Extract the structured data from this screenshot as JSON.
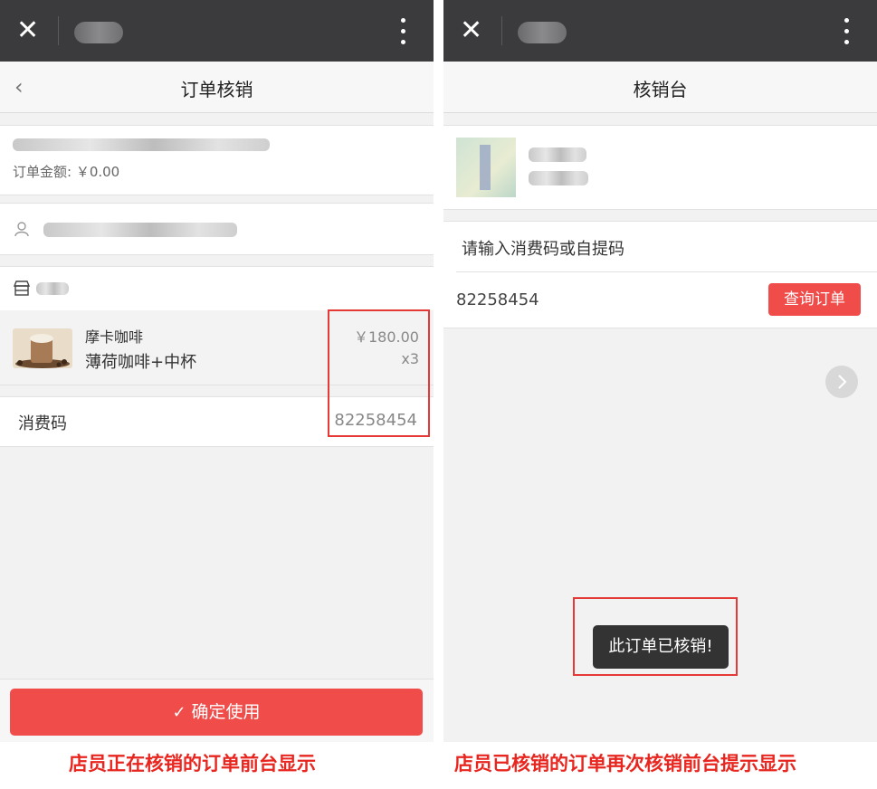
{
  "left": {
    "nav_title": "订单核销",
    "back_glyph": "‹",
    "order_amount": "订单金额: ￥0.00",
    "product": {
      "name": "摩卡咖啡",
      "spec": "薄荷咖啡+中杯",
      "price": "￥180.00",
      "qty": "x3"
    },
    "code_label": "消费码",
    "code_value": "82258454",
    "confirm_label": "确定使用",
    "confirm_icon": "check-icon"
  },
  "right": {
    "nav_title": "核销台",
    "input_prompt": "请输入消费码或自提码",
    "input_value": "82258454",
    "query_label": "查询订单",
    "toast": "此订单已核销!"
  },
  "captions": {
    "left": "店员正在核销的订单前台显示",
    "right": "店员已核销的订单再次核销前台提示显示"
  },
  "colors": {
    "topbar": "#3b3b3d",
    "accent_red": "#ef4c4a",
    "caption_red": "#e8261f",
    "highlight_box": "#e53935"
  },
  "icons": [
    "close-icon",
    "more-icon",
    "back-chevron-icon",
    "user-icon",
    "store-icon",
    "check-icon",
    "chevron-right-icon"
  ]
}
